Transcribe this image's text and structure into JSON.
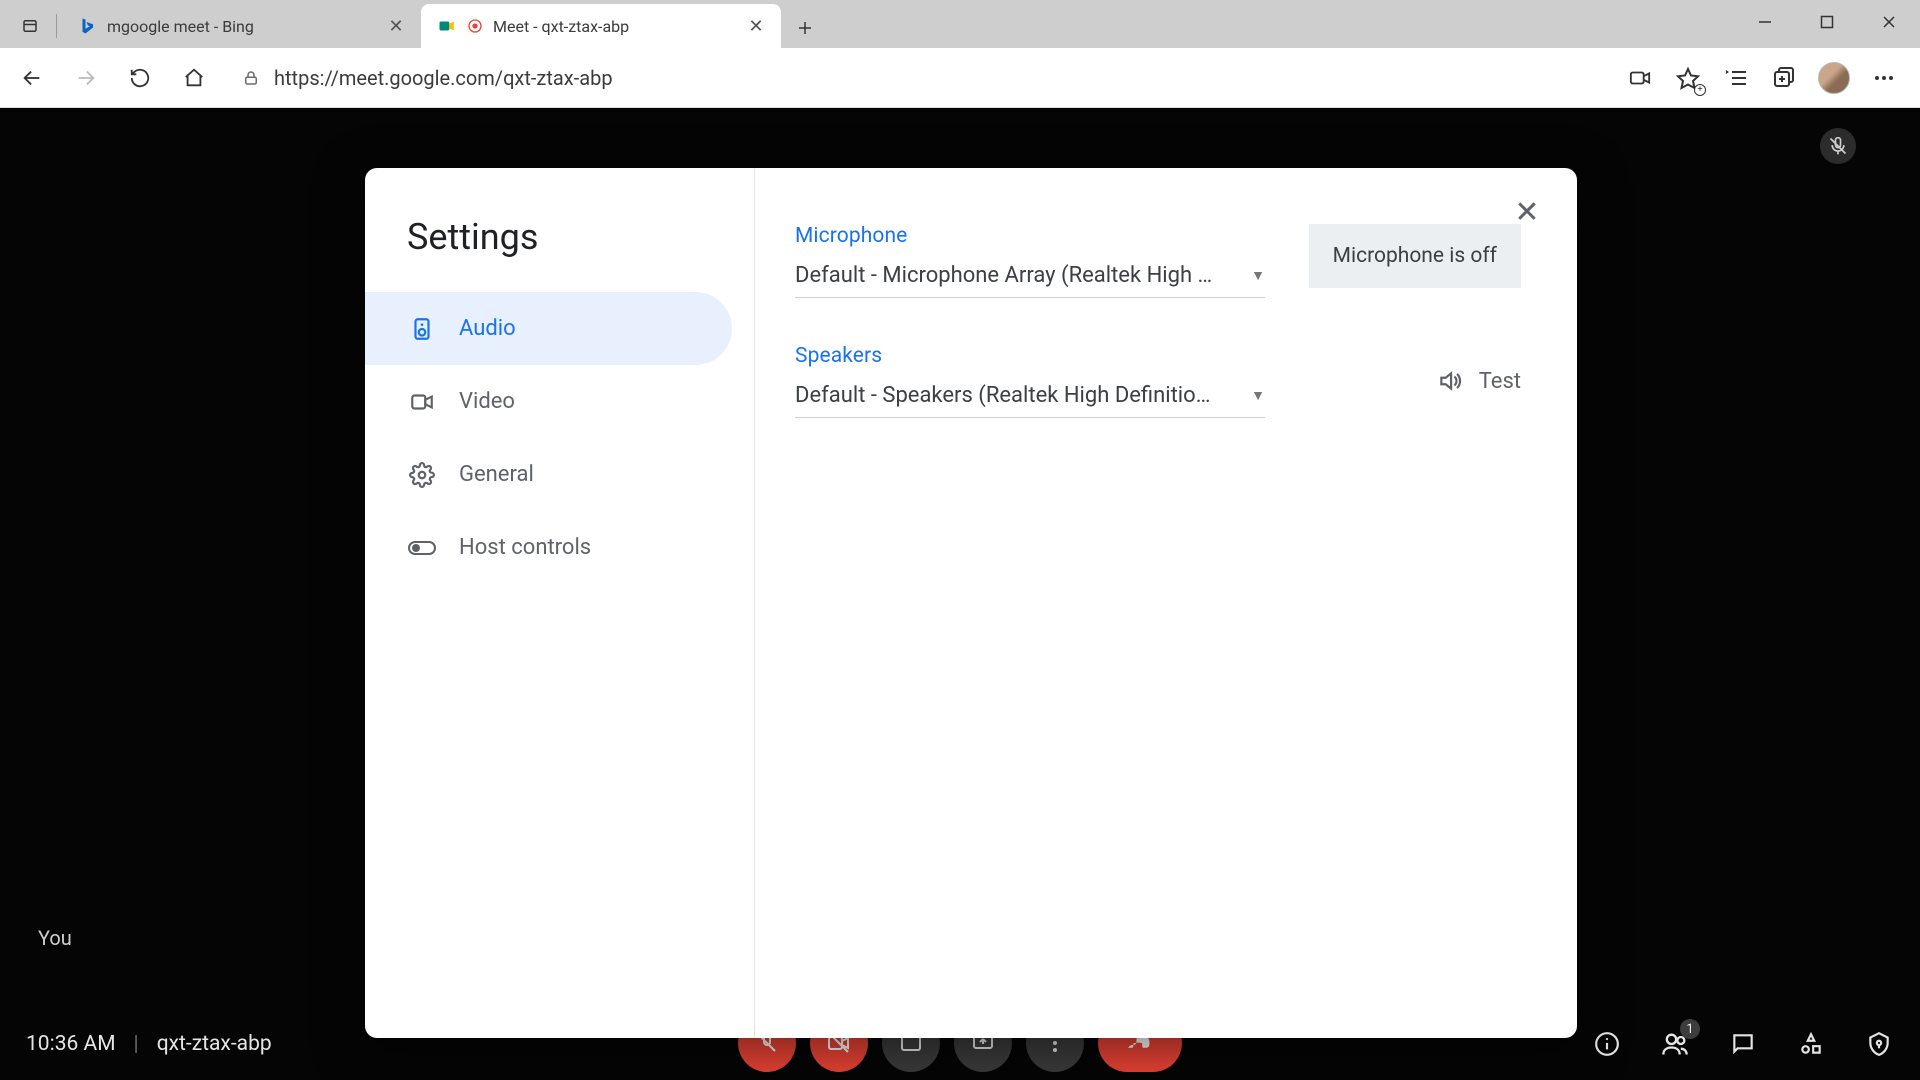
{
  "browser": {
    "tabs": [
      {
        "title": "mgoogle meet - Bing",
        "active": false
      },
      {
        "title": "Meet - qxt-ztax-abp",
        "active": true
      }
    ],
    "url": "https://meet.google.com/qxt-ztax-abp"
  },
  "meet": {
    "you_label": "You",
    "time": "10:36 AM",
    "code": "qxt-ztax-abp",
    "participants_badge": "1"
  },
  "settings": {
    "title": "Settings",
    "sidebar": {
      "items": [
        {
          "label": "Audio"
        },
        {
          "label": "Video"
        },
        {
          "label": "General"
        },
        {
          "label": "Host controls"
        }
      ]
    },
    "audio": {
      "microphone_label": "Microphone",
      "microphone_value": "Default - Microphone Array (Realtek High …",
      "microphone_status": "Microphone is off",
      "speakers_label": "Speakers",
      "speakers_value": "Default - Speakers (Realtek High Definitio…",
      "test_label": "Test"
    }
  }
}
